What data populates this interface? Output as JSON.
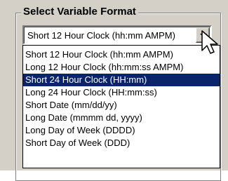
{
  "group_title": "Select Variable Format",
  "combo": {
    "value": "Short 12 Hour Clock (hh:mm AMPM)",
    "button_icon": "chevron-down-icon"
  },
  "options": [
    "Short 12 Hour Clock (hh:mm AMPM)",
    "Long 12 Hour Clock (hh:mm:ss AMPM)",
    "Short 24 Hour Clock (HH:mm)",
    "Long 24 Hour Clock (HH:mm:ss)",
    "Short Date (mm/dd/yy)",
    "Long Date (mmmm dd, yyyy)",
    "Long Day of Week (DDDD)",
    "Short Day of Week (DDD)"
  ],
  "selected_option": "Short 24 Hour Clock (HH:mm)",
  "colors": {
    "highlight": "#0a246a",
    "panel": "#d4d0c8"
  }
}
